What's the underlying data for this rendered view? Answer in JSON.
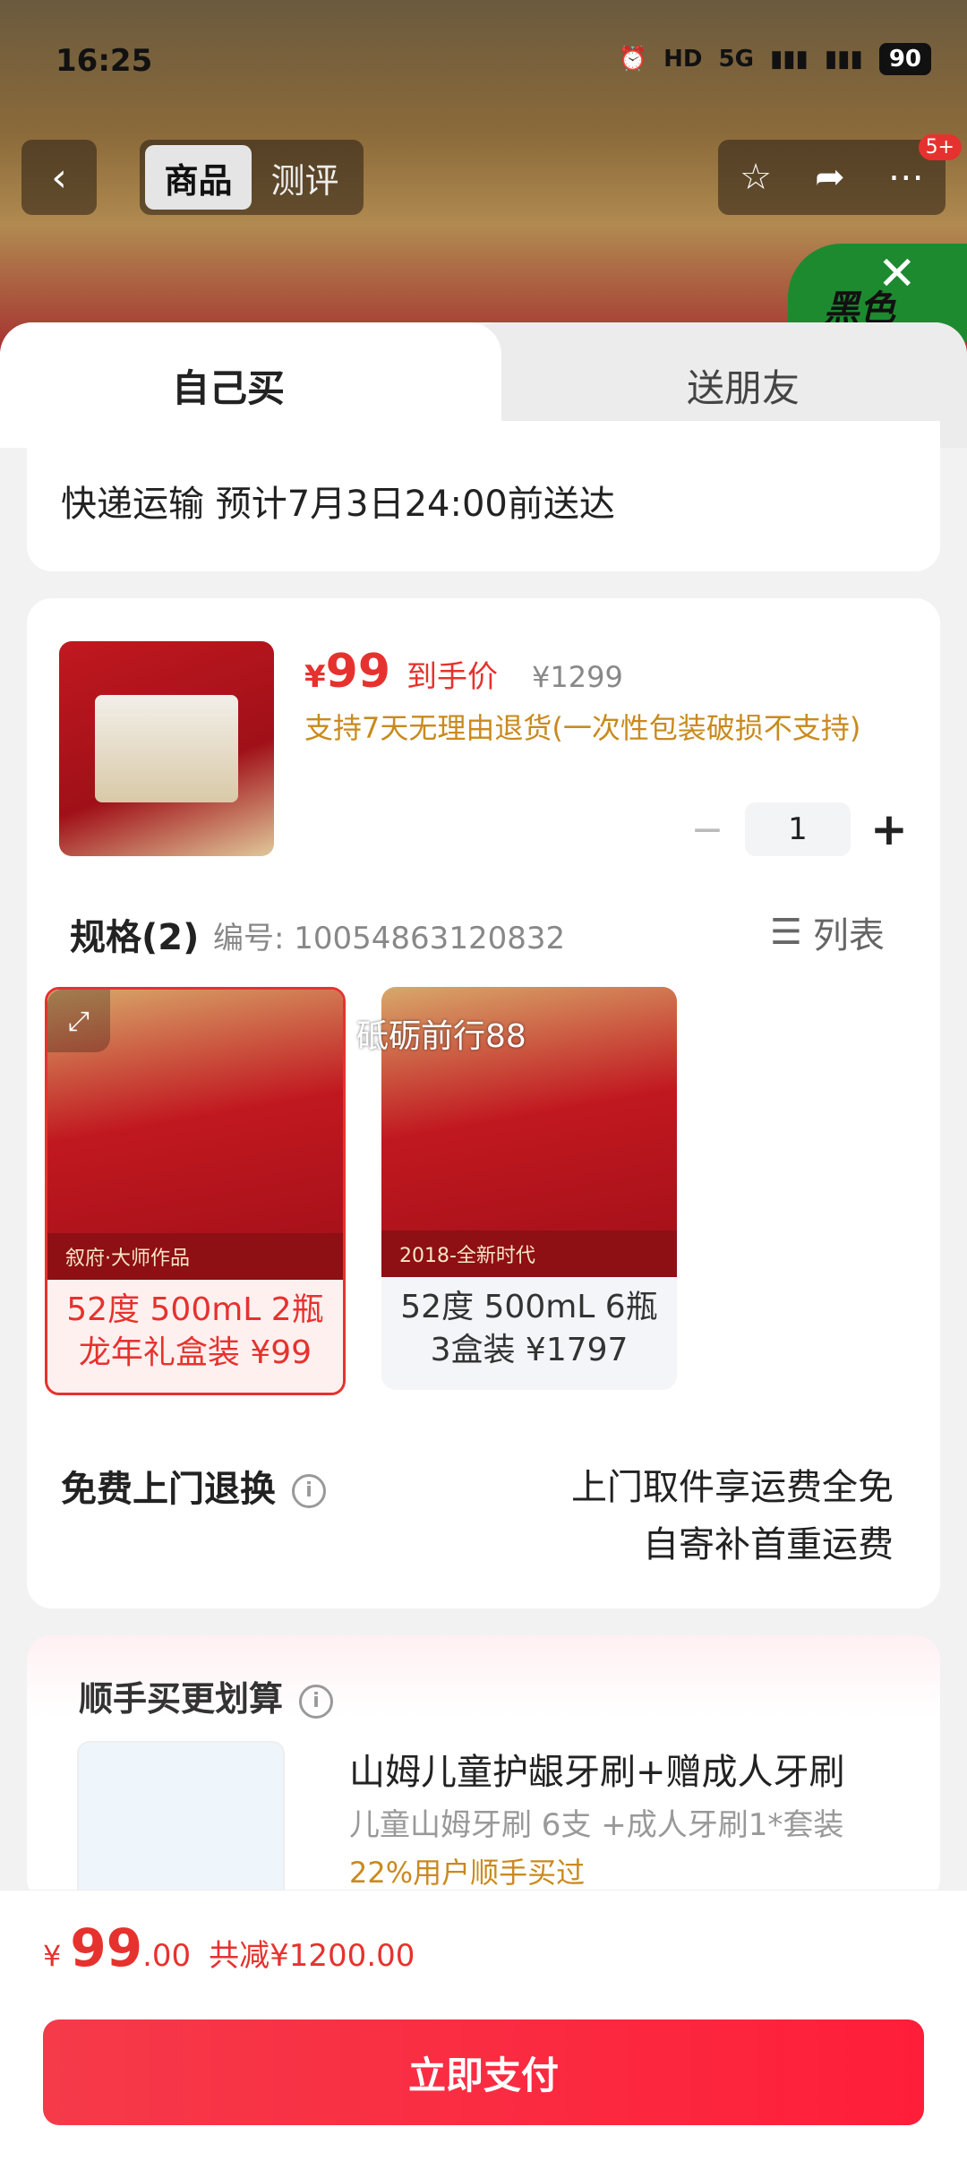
{
  "status_bar": {
    "time": "16:25",
    "network": "5G",
    "battery": "90"
  },
  "nav": {
    "tabs": [
      "商品",
      "测评"
    ],
    "active_tab": 0,
    "badge": "5+"
  },
  "banner_corner_text": "黑色",
  "purchase_tabs": [
    "自己买",
    "送朋友"
  ],
  "shipping": {
    "text": "快递运输 预计7月3日24:00前送达"
  },
  "product": {
    "price_currency": "¥",
    "price": "99",
    "price_label": "到手价",
    "original_price": "¥1299",
    "return_note": "支持7天无理由退货(一次性包装破损不支持)",
    "quantity": "1"
  },
  "spec": {
    "title": "规格(2)",
    "code": "编号: 10054863120832",
    "list_label": "列表",
    "options": [
      {
        "line1": "52度 500mL 2瓶",
        "line2": "龙年礼盒装 ¥99",
        "selected": true,
        "img_caption": "叙府·大师作品"
      },
      {
        "line1": "52度 500mL 6瓶",
        "line2": "3盒装 ¥1797",
        "selected": false,
        "img_caption": "2018-全新时代"
      }
    ],
    "watermark": "砥砺前行88"
  },
  "free_return": {
    "title": "免费上门退换",
    "line1": "上门取件享运费全免",
    "line2": "自寄补首重运费"
  },
  "addon": {
    "title": "顺手买更划算",
    "name": "山姆儿童护龈牙刷+赠成人牙刷",
    "sub": "儿童山姆牙刷 6支 +成人牙刷1*套装",
    "tag": "22%用户顺手买过"
  },
  "footer": {
    "currency": "¥",
    "total_int": "99",
    "total_dec": ".00",
    "savings": "共减¥1200.00",
    "pay_label": "立即支付"
  },
  "colors": {
    "accent": "#e6322e",
    "note": "#c98a1e"
  }
}
